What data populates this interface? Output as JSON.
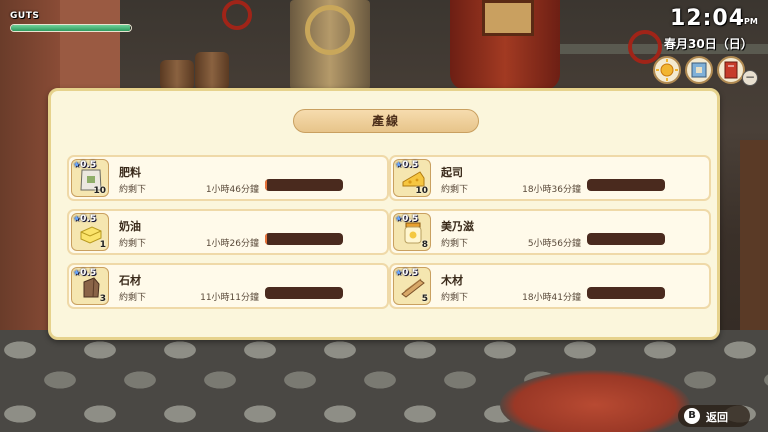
{
  "hud": {
    "guts_label": "GUTS",
    "guts_level": 0.99,
    "time": "12:04",
    "ampm": "PM",
    "date": "春月30日（日）",
    "icons": [
      "sun-weather-icon",
      "map-icon",
      "diary-icon"
    ]
  },
  "panel": {
    "title": "產線",
    "items": [
      {
        "name": "肥料",
        "quality": "0.5",
        "count": "10",
        "remain_label": "約剩下",
        "time": "1小時46分鐘",
        "icon": "fertilizer-bag-icon",
        "progress": 0.02
      },
      {
        "name": "起司",
        "quality": "0.5",
        "count": "10",
        "remain_label": "約剩下",
        "time": "18小時36分鐘",
        "icon": "cheese-icon",
        "progress": 0.0
      },
      {
        "name": "奶油",
        "quality": "0.5",
        "count": "1",
        "remain_label": "約剩下",
        "time": "1小時26分鐘",
        "icon": "butter-icon",
        "progress": 0.02
      },
      {
        "name": "美乃滋",
        "quality": "0.5",
        "count": "8",
        "remain_label": "約剩下",
        "time": "5小時56分鐘",
        "icon": "mayonnaise-icon",
        "progress": 0.0
      },
      {
        "name": "石材",
        "quality": "0.5",
        "count": "3",
        "remain_label": "約剩下",
        "time": "11小時11分鐘",
        "icon": "stone-icon",
        "progress": 0.0
      },
      {
        "name": "木材",
        "quality": "0.5",
        "count": "5",
        "remain_label": "約剩下",
        "time": "18小時41分鐘",
        "icon": "lumber-icon",
        "progress": 0.0
      }
    ]
  },
  "footer": {
    "button_glyph": "B",
    "back_label": "返回"
  },
  "colors": {
    "panel_bg": "#fbf6dc",
    "bar_bg": "#4a2a1e",
    "bar_fill": "#e8743a",
    "guts_fill": "#2e9a5e"
  }
}
